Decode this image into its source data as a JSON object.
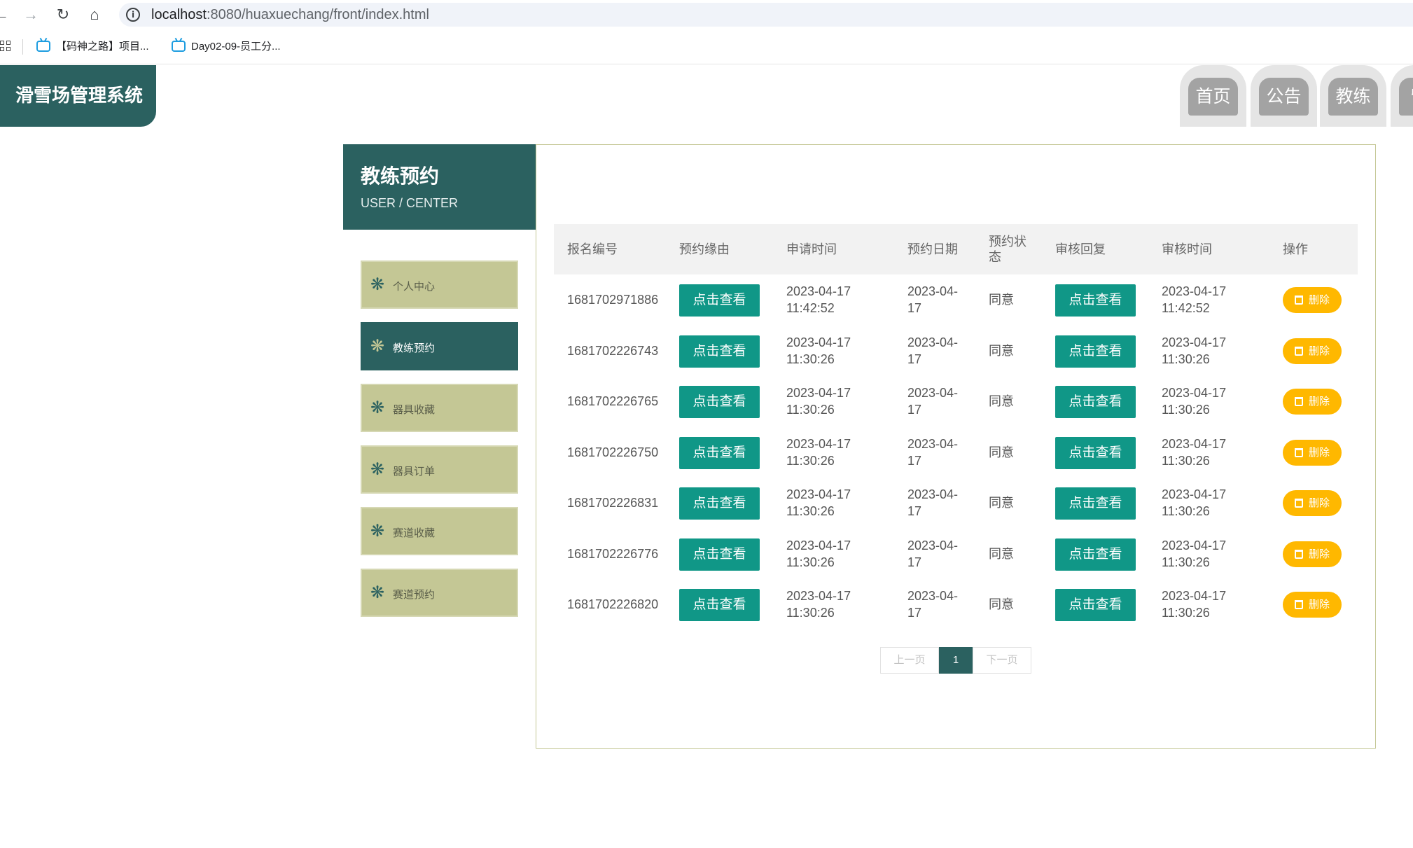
{
  "browser": {
    "url_host": "localhost",
    "url_path": ":8080/huaxuechang/front/index.html",
    "bookmarks": [
      "【码神之路】项目...",
      "Day02-09-员工分..."
    ]
  },
  "header": {
    "logo_text": "滑雪场管理系统",
    "nav": [
      "首页",
      "公告",
      "教练",
      "留"
    ]
  },
  "sidebar": {
    "title": "教练预约",
    "subtitle": "USER / CENTER",
    "items": [
      {
        "label": "个人中心",
        "active": false
      },
      {
        "label": "教练预约",
        "active": true
      },
      {
        "label": "器具收藏",
        "active": false
      },
      {
        "label": "器具订单",
        "active": false
      },
      {
        "label": "赛道收藏",
        "active": false
      },
      {
        "label": "赛道预约",
        "active": false
      }
    ]
  },
  "table": {
    "columns": [
      "报名编号",
      "预约缘由",
      "申请时间",
      "预约日期",
      "预约状态",
      "审核回复",
      "审核时间",
      "操作"
    ],
    "view_label": "点击查看",
    "delete_label": "删除",
    "rows": [
      {
        "id": "1681702971886",
        "apply_time": "2023-04-17 11:42:52",
        "date": "2023-04-17",
        "status": "同意",
        "review_time": "2023-04-17 11:42:52"
      },
      {
        "id": "1681702226743",
        "apply_time": "2023-04-17 11:30:26",
        "date": "2023-04-17",
        "status": "同意",
        "review_time": "2023-04-17 11:30:26"
      },
      {
        "id": "1681702226765",
        "apply_time": "2023-04-17 11:30:26",
        "date": "2023-04-17",
        "status": "同意",
        "review_time": "2023-04-17 11:30:26"
      },
      {
        "id": "1681702226750",
        "apply_time": "2023-04-17 11:30:26",
        "date": "2023-04-17",
        "status": "同意",
        "review_time": "2023-04-17 11:30:26"
      },
      {
        "id": "1681702226831",
        "apply_time": "2023-04-17 11:30:26",
        "date": "2023-04-17",
        "status": "同意",
        "review_time": "2023-04-17 11:30:26"
      },
      {
        "id": "1681702226776",
        "apply_time": "2023-04-17 11:30:26",
        "date": "2023-04-17",
        "status": "同意",
        "review_time": "2023-04-17 11:30:26"
      },
      {
        "id": "1681702226820",
        "apply_time": "2023-04-17 11:30:26",
        "date": "2023-04-17",
        "status": "同意",
        "review_time": "2023-04-17 11:30:26"
      }
    ]
  },
  "pager": {
    "prev": "上一页",
    "current": "1",
    "next": "下一页"
  },
  "colors": {
    "primary": "#2b6160",
    "teal_button": "#109787",
    "warn": "#ffb800",
    "sidebar_item": "#c4c795"
  }
}
